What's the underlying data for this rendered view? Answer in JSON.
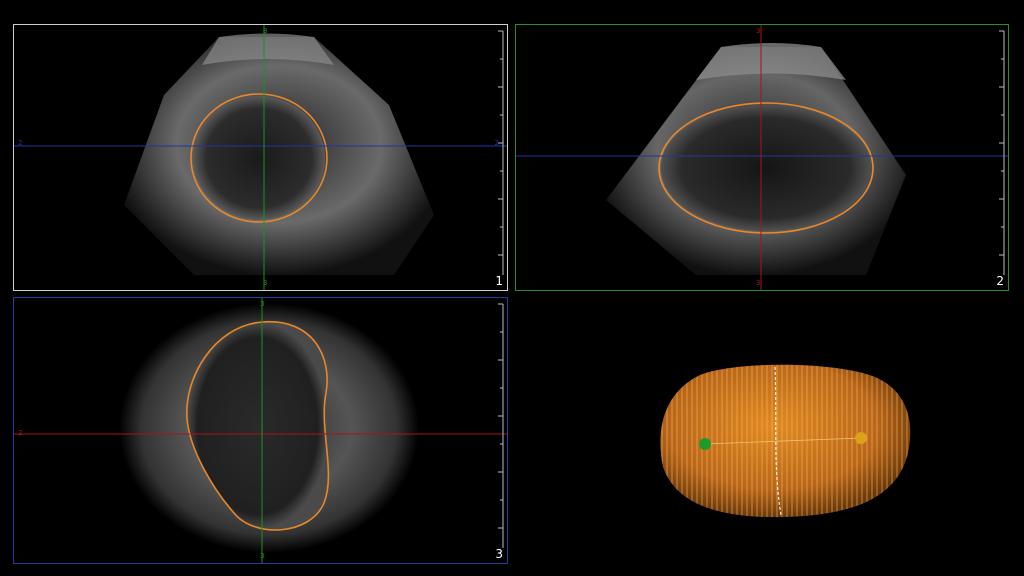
{
  "views": [
    {
      "number": "1",
      "border_color": "#cfcfcf",
      "h_line_color": "#2233aa",
      "v_line_color": "#1f8f1f",
      "top_mark": "3",
      "bottom_mark": "3",
      "left_mark": "2",
      "right_mark": "2"
    },
    {
      "number": "2",
      "border_color": "#2e8b2e",
      "h_line_color": "#2233aa",
      "v_line_color": "#a01818",
      "top_mark": "3",
      "bottom_mark": "3",
      "left_mark": "",
      "right_mark": ""
    },
    {
      "number": "3",
      "border_color": "#2c3b9a",
      "h_line_color": "#a01818",
      "v_line_color": "#1f8f1f",
      "top_mark": "3",
      "bottom_mark": "3",
      "left_mark": "2",
      "right_mark": ""
    }
  ],
  "contour_color": "#e8872a",
  "render3d": {
    "fill_color": "#c8761a",
    "marker_left_color": "#1f9a2a",
    "marker_right_color": "#d9a21a"
  }
}
